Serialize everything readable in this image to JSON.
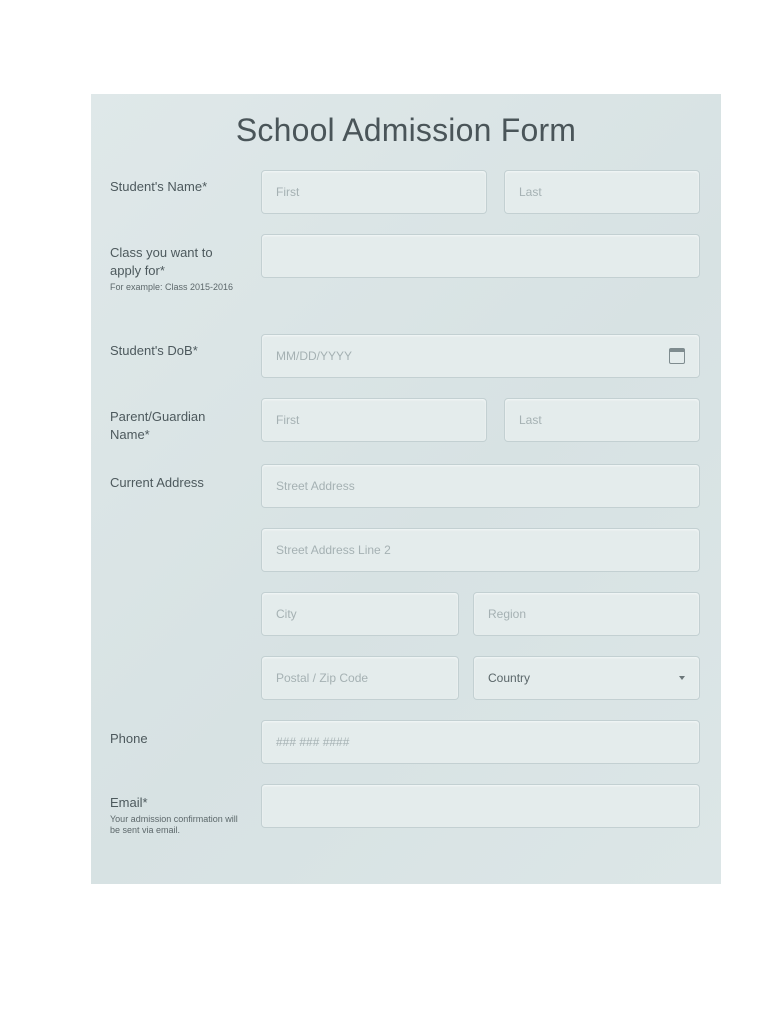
{
  "form": {
    "title": "School Admission Form"
  },
  "student_name": {
    "label": "Student's Name*",
    "first_placeholder": "First",
    "last_placeholder": "Last"
  },
  "class": {
    "label": "Class you want to apply for*",
    "hint": "For example: Class 2015-2016",
    "value": ""
  },
  "dob": {
    "label": "Student's DoB*",
    "placeholder": "MM/DD/YYYY",
    "icon": "calendar-icon"
  },
  "parent_name": {
    "label": "Parent/Guardian Name*",
    "first_placeholder": "First",
    "last_placeholder": "Last"
  },
  "address": {
    "label": "Current Address",
    "street_placeholder": "Street Address",
    "street2_placeholder": "Street Address Line 2",
    "city_placeholder": "City",
    "region_placeholder": "Region",
    "postal_placeholder": "Postal / Zip Code",
    "country_value": "Country",
    "country_icon": "chevron-down-icon"
  },
  "phone": {
    "label": "Phone",
    "placeholder": "### ### ####"
  },
  "email": {
    "label": "Email*",
    "hint": "Your admission confirmation will be sent via email.",
    "value": ""
  }
}
